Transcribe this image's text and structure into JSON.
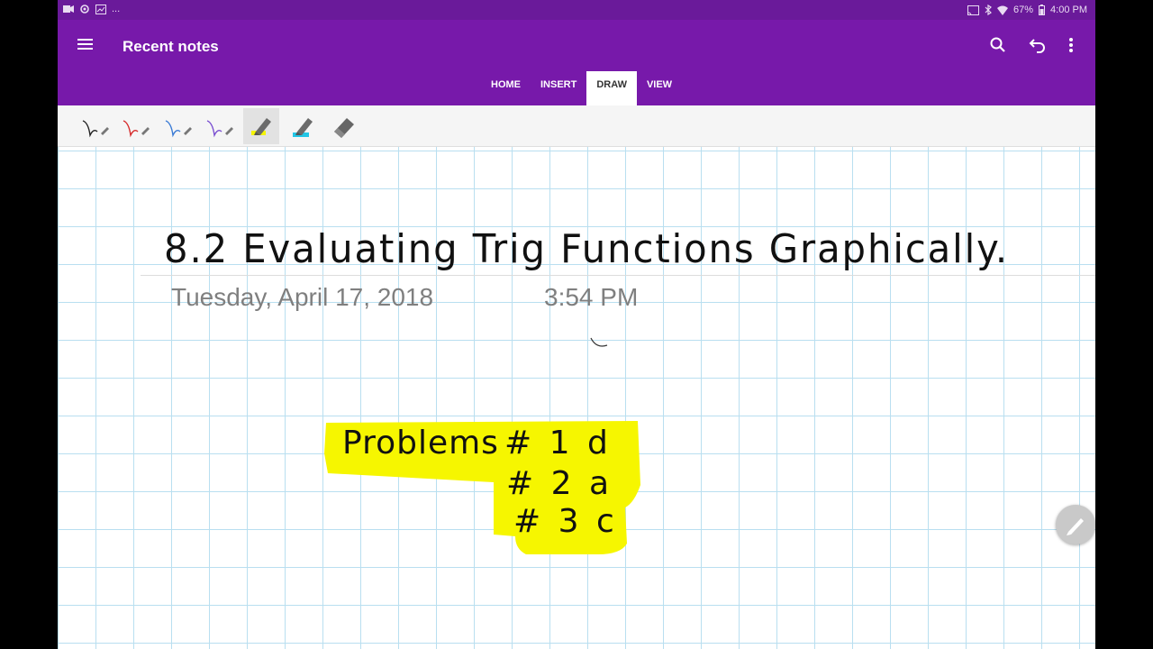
{
  "status_bar": {
    "left_icons": [
      "video-icon",
      "settings-sync-icon",
      "gallery-icon",
      "more-icon"
    ],
    "more": "...",
    "battery": "67%",
    "time": "4:00 PM",
    "right_icons": [
      "cast-icon",
      "bluetooth-icon",
      "wifi-icon",
      "battery-icon"
    ]
  },
  "app_bar": {
    "title": "Recent notes",
    "icons": [
      "menu-icon",
      "search-icon",
      "undo-icon",
      "overflow-icon"
    ]
  },
  "tabs": [
    {
      "label": "HOME",
      "active": false
    },
    {
      "label": "INSERT",
      "active": false
    },
    {
      "label": "DRAW",
      "active": true
    },
    {
      "label": "VIEW",
      "active": false
    }
  ],
  "tools": [
    {
      "name": "black-pen",
      "color": "#222222"
    },
    {
      "name": "red-pen",
      "color": "#d62b2b"
    },
    {
      "name": "blue-pen",
      "color": "#3a7bd5"
    },
    {
      "name": "purple-pen",
      "color": "#7a4fd1"
    },
    {
      "name": "yellow-highlighter",
      "color": "#f5f500",
      "selected": true
    },
    {
      "name": "cyan-highlighter",
      "color": "#22c6e6"
    },
    {
      "name": "eraser",
      "color": "#666666"
    }
  ],
  "page": {
    "handwritten_title": "8.2 Evaluating Trig Functions Graphically.",
    "date": "Tuesday, April 17, 2018",
    "time": "3:54 PM",
    "handwritten_note": {
      "heading": "Problems",
      "items": [
        "# 1 d",
        "# 2 a",
        "# 3 c"
      ],
      "highlight_color": "#f6f600"
    }
  },
  "colors": {
    "status_bar": "#6a1a9a",
    "app_bar": "#7719aa",
    "grid": "#b9dff0"
  }
}
